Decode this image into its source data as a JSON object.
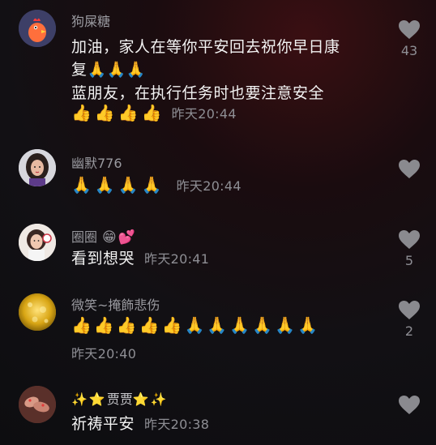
{
  "comments": [
    {
      "username": "狗屎糖",
      "lines": [
        "加油，家人在等你平安回去祝你早日康",
        "复🙏🙏🙏",
        "蓝朋友，在执行任务时也要注意安全"
      ],
      "emojis": "👍👍👍👍",
      "timestamp": "昨天20:44",
      "likes": "43",
      "avatar_icon": "chicken-avatar-icon"
    },
    {
      "username": "幽默776",
      "lines": [],
      "emojis": "🙏🙏🙏🙏",
      "timestamp": "昨天20:44",
      "likes": "",
      "avatar_icon": "woman-avatar-icon"
    },
    {
      "username": "圈圈",
      "username_emojis": "😁💕",
      "lines": [
        "看到想哭"
      ],
      "emojis": "",
      "timestamp": "昨天20:41",
      "likes": "5",
      "avatar_icon": "girl-avatar-icon"
    },
    {
      "username": "微笑~掩飾悲伤",
      "lines": [],
      "emojis": "👍👍👍👍👍🙏🙏🙏🙏🙏🙏",
      "timestamp": "昨天20:40",
      "likes": "2",
      "avatar_icon": "gold-avatar-icon"
    },
    {
      "username_prefix": "✨⭐",
      "username": "贾贾",
      "username_suffix": "⭐✨",
      "lines": [
        "祈祷平安"
      ],
      "emojis": "",
      "timestamp": "昨天20:38",
      "likes": "",
      "avatar_icon": "hands-avatar-icon"
    }
  ],
  "colors": {
    "background": "#121014",
    "username": "#9a9aa0",
    "text": "#f2f2f2",
    "meta": "#8e8e94",
    "heart": "#8a8a8f"
  }
}
